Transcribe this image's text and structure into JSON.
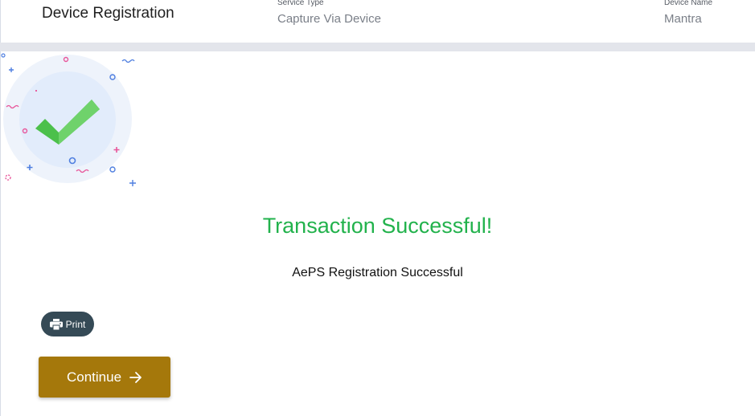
{
  "header": {
    "title": "Device Registration",
    "service_type": {
      "label": "Service Type",
      "value": "Capture Via Device"
    },
    "device_name": {
      "label": "Device Name",
      "value": "Mantra"
    }
  },
  "result": {
    "title": "Transaction Successful!",
    "message": "AePS Registration Successful"
  },
  "actions": {
    "print_label": "Print",
    "continue_label": "Continue"
  },
  "icons": {
    "success": "checkmark-icon",
    "print": "printer-icon",
    "continue": "arrow-right-icon"
  },
  "colors": {
    "success_text": "#22b24c",
    "print_button": "#354a56",
    "continue_button": "#a5780b",
    "checkmark": "#5cc95a"
  }
}
